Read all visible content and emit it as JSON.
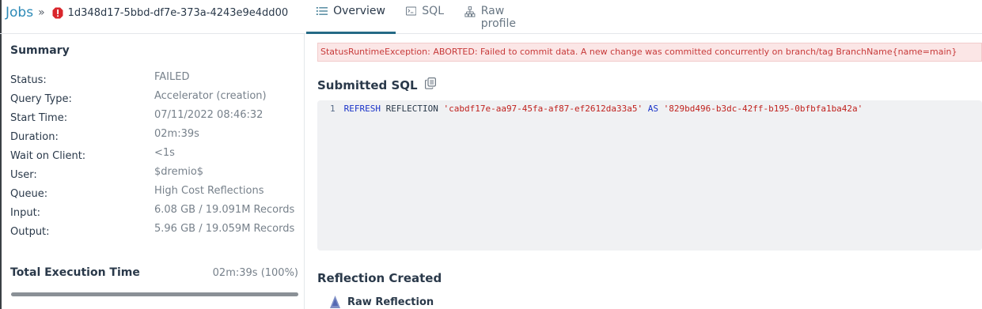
{
  "breadcrumb": {
    "jobs_label": "Jobs",
    "separator": "»",
    "job_id": "1d348d17-5bbd-df7e-373a-4243e9e4dd00",
    "status_icon": "error-octagon-icon"
  },
  "tabs": [
    {
      "label": "Overview",
      "icon": "list-icon",
      "active": true
    },
    {
      "label": "SQL",
      "icon": "terminal-icon",
      "active": false
    },
    {
      "label": "Raw profile",
      "icon": "tree-icon",
      "active": false
    }
  ],
  "summary": {
    "title": "Summary",
    "rows": [
      {
        "label": "Status:",
        "value": "FAILED"
      },
      {
        "label": "Query Type:",
        "value": "Accelerator (creation)"
      },
      {
        "label": "Start Time:",
        "value": "07/11/2022 08:46:32"
      },
      {
        "label": "Duration:",
        "value": "02m:39s"
      },
      {
        "label": "Wait on Client:",
        "value": "<1s"
      },
      {
        "label": "User:",
        "value": "$dremio$"
      },
      {
        "label": "Queue:",
        "value": "High Cost Reflections"
      },
      {
        "label": "Input:",
        "value": "6.08 GB / 19.091M Records"
      },
      {
        "label": "Output:",
        "value": "5.96 GB / 19.059M Records"
      }
    ],
    "total_label": "Total Execution Time",
    "total_value": "02m:39s (100%)",
    "total_percent": 100
  },
  "error_message": "StatusRuntimeException: ABORTED: Failed to commit data. A new change was committed concurrently on branch/tag BranchName{name=main}",
  "submitted_sql": {
    "title": "Submitted SQL",
    "line_number": "1",
    "tokens": {
      "kw1": "REFRESH",
      "word": "REFLECTION",
      "str1": "'cabdf17e-aa97-45fa-af87-ef2612da33a5'",
      "kw2": "AS",
      "str2": "'829bd496-b3dc-42ff-b195-0bfbfa1ba42a'"
    }
  },
  "reflection_created": {
    "title": "Reflection Created",
    "item_label": "Raw Reflection"
  },
  "colors": {
    "accent": "#2d8ab7",
    "tab_underline": "#256a86",
    "error_text": "#c73a3a",
    "error_bg": "#fbe6e6"
  }
}
